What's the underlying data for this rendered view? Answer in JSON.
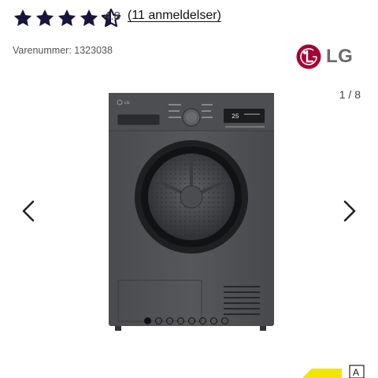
{
  "rating": {
    "value": "4.8",
    "reviews_label": "(11 anmeldelser)",
    "stars": [
      1,
      1,
      1,
      1,
      0.5
    ],
    "star_color": "#15163a"
  },
  "product": {
    "sku_label": "Varenummer: 1323038",
    "brand": "LG",
    "brand_color": "#a50034",
    "display_readout": "25"
  },
  "gallery": {
    "counter": "1 / 8",
    "dot_count": 8,
    "active_index": 0
  },
  "energy_label": {
    "class": "A",
    "band_color": "#f2e600"
  },
  "icons": {
    "prev": "chevron-left-icon",
    "next": "chevron-right-icon",
    "star": "star-icon"
  }
}
